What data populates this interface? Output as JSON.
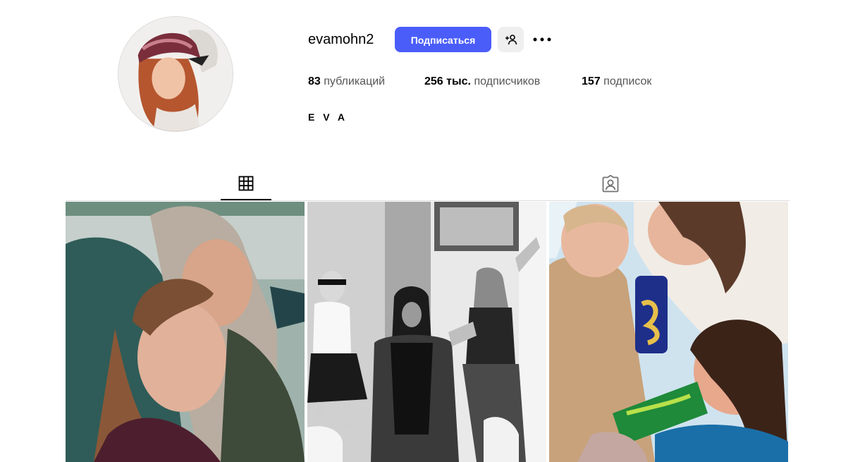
{
  "profile": {
    "username": "evamohn2",
    "follow_label": "Подписаться",
    "bio_name": "E V A",
    "avatar_icon": "profile-photo"
  },
  "stats": {
    "posts_num": "83",
    "posts_label": "публикаций",
    "followers_num": "256 тыс.",
    "followers_label": "подписчиков",
    "following_num": "157",
    "following_label": "подписок"
  },
  "icons": {
    "add_user": "add-user-icon",
    "more": "more-options-icon",
    "grid_tab": "grid-icon",
    "tagged_tab": "tagged-person-icon"
  },
  "colors": {
    "accent": "#4a5df9",
    "secondary_button": "#efefef",
    "divider": "#dbdbdb"
  },
  "posts": [
    {
      "type": "photo"
    },
    {
      "type": "photo"
    },
    {
      "type": "photo"
    }
  ]
}
